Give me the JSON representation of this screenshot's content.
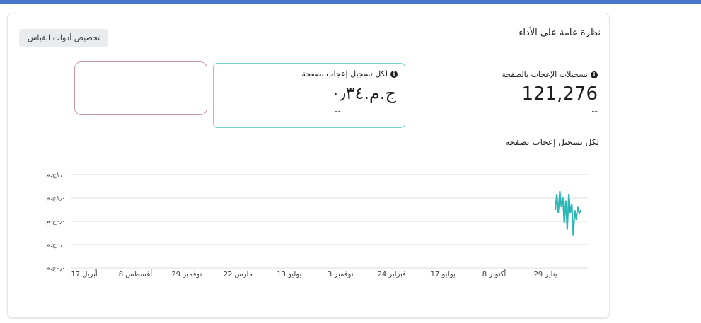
{
  "overview": {
    "title": "نظرة عامة على الأداء",
    "customize_label": "تخصيص أدوات القياس"
  },
  "metrics": {
    "page_likes": {
      "label": "تسجيلات الإعجاب بالصفحة",
      "value": "121,276",
      "compare": "--"
    },
    "cost_per_like": {
      "label": "لكل تسجيل إعجاب بصفحة",
      "value": "ج.م.‏٠٫٣٤",
      "compare": "--"
    }
  },
  "chart": {
    "title": "لكل تسجيل إعجاب بصفحة"
  },
  "chart_data": {
    "type": "line",
    "y_tick_labels": [
      "١٫٠ج.م.",
      "١٫٠ج.م.",
      "٠٫٠ج.م.",
      "٠٫٠ج.م.",
      "٠٫٠ج.م."
    ],
    "x_tick_labels": [
      "29 يناير",
      "8 أكتوبر",
      "17 يوليو",
      "24 فبراير",
      "3 نوفمبر",
      "13 يوليو",
      "22 مارس",
      "29 نوفمبر",
      "8 أغسطس",
      "17 أبريل"
    ],
    "series": [
      {
        "color": "#2bb5b5",
        "values": [
          0.9,
          1.15,
          0.85,
          1.2,
          0.95,
          1.1,
          0.7,
          1.05,
          0.6,
          1.15,
          0.85,
          1.0,
          0.5,
          0.9,
          0.75,
          0.95,
          0.85,
          0.9
        ]
      }
    ]
  }
}
